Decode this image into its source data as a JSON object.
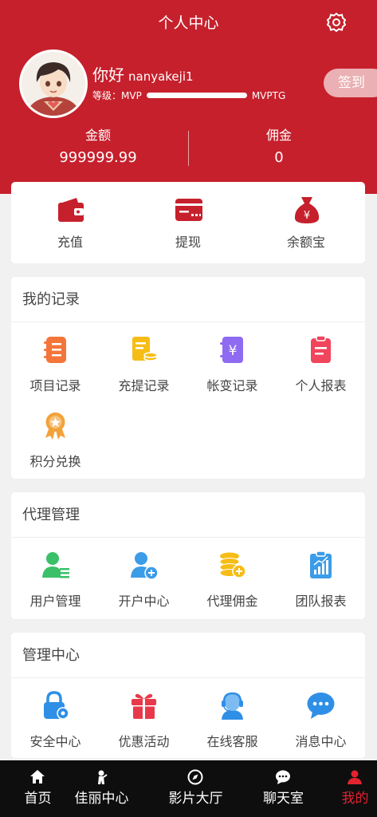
{
  "header": {
    "title": "个人中心",
    "greeting": "你好",
    "username": "nanyakeji1",
    "level_label": "等级：",
    "level_current": "MVP",
    "level_next": "MVPTG",
    "signin_label": "签到",
    "balance_label": "金额",
    "balance_value": "999999.99",
    "commission_label": "佣金",
    "commission_value": "0"
  },
  "quick_actions": [
    {
      "label": "充值",
      "icon": "wallet-icon"
    },
    {
      "label": "提现",
      "icon": "card-icon"
    },
    {
      "label": "余额宝",
      "icon": "money-bag-icon"
    }
  ],
  "records": {
    "title": "我的记录",
    "items": [
      {
        "label": "项目记录",
        "icon": "notebook-icon"
      },
      {
        "label": "充提记录",
        "icon": "bill-coins-icon"
      },
      {
        "label": "帐变记录",
        "icon": "yen-note-icon"
      },
      {
        "label": "个人报表",
        "icon": "clipboard-icon"
      },
      {
        "label": "积分兑换",
        "icon": "medal-icon"
      }
    ]
  },
  "agent": {
    "title": "代理管理",
    "items": [
      {
        "label": "用户管理",
        "icon": "user-list-icon"
      },
      {
        "label": "开户中心",
        "icon": "add-user-icon"
      },
      {
        "label": "代理佣金",
        "icon": "coins-icon"
      },
      {
        "label": "团队报表",
        "icon": "bar-report-icon"
      }
    ]
  },
  "management": {
    "title": "管理中心",
    "items": [
      {
        "label": "安全中心",
        "icon": "lock-gear-icon"
      },
      {
        "label": "优惠活动",
        "icon": "gift-icon"
      },
      {
        "label": "在线客服",
        "icon": "headset-agent-icon"
      },
      {
        "label": "消息中心",
        "icon": "chat-bubble-icon"
      }
    ]
  },
  "tabbar": [
    {
      "label": "首页",
      "icon": "home-icon"
    },
    {
      "label": "佳丽中心",
      "icon": "figure-icon"
    },
    {
      "label": "影片大厅",
      "icon": "compass-icon"
    },
    {
      "label": "聊天室",
      "icon": "chat-icon"
    },
    {
      "label": "我的",
      "icon": "person-icon",
      "active": true
    }
  ],
  "colors": {
    "brand": "#c6202c",
    "tab_active": "#e3232f",
    "tabbar_bg": "#0e0e0e"
  }
}
